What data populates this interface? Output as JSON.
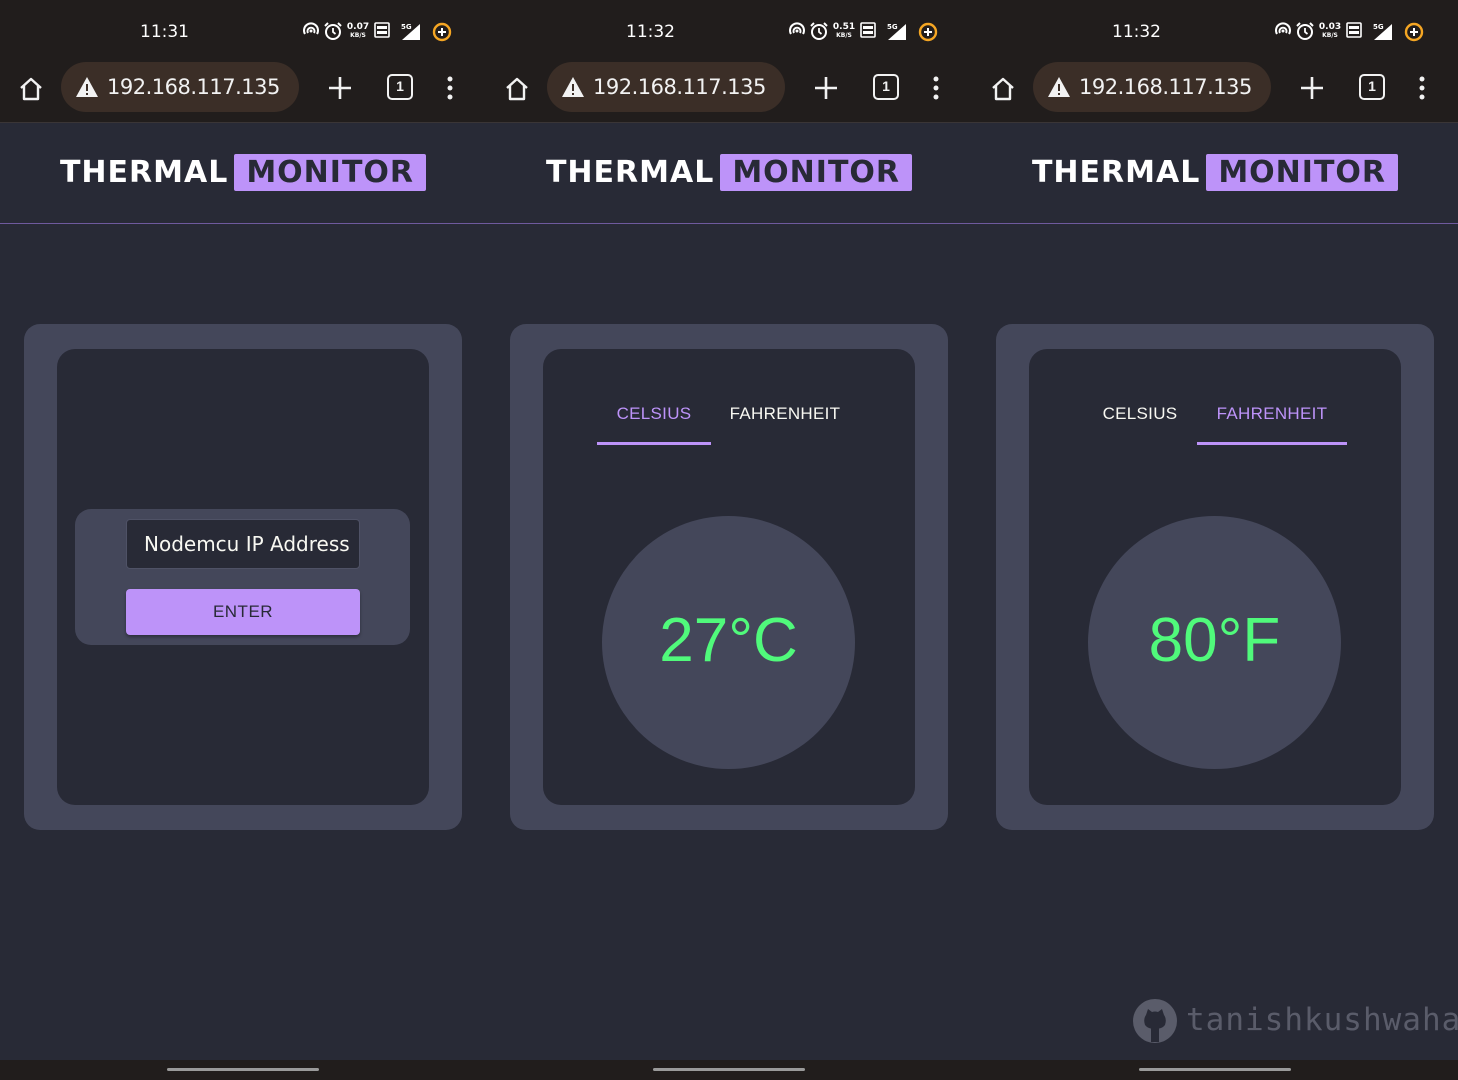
{
  "colors": {
    "background": "#282a36",
    "card": "#44475a",
    "accent": "#bd93f9",
    "reading": "#50fa7b",
    "text": "#f8f8f2",
    "system_bar": "#211d1c",
    "url_pill": "#3b2e27"
  },
  "screens": [
    {
      "status": {
        "time": "11:31",
        "speed_value": "0.07",
        "speed_unit": "KB/S",
        "network": "5G"
      },
      "browser": {
        "url": "192.168.117.135",
        "tab_count": "1"
      },
      "header": {
        "title_part1": "THERMAL",
        "title_part2": "MONITOR"
      },
      "form": {
        "ip_placeholder": "Nodemcu IP Address",
        "enter_label": "ENTER"
      }
    },
    {
      "status": {
        "time": "11:32",
        "speed_value": "0.51",
        "speed_unit": "KB/S",
        "network": "5G"
      },
      "browser": {
        "url": "192.168.117.135",
        "tab_count": "1"
      },
      "header": {
        "title_part1": "THERMAL",
        "title_part2": "MONITOR"
      },
      "tabs": {
        "celsius": "CELSIUS",
        "fahrenheit": "FAHRENHEIT",
        "active": "celsius"
      },
      "reading": "27°C"
    },
    {
      "status": {
        "time": "11:32",
        "speed_value": "0.03",
        "speed_unit": "KB/S",
        "network": "5G"
      },
      "browser": {
        "url": "192.168.117.135",
        "tab_count": "1"
      },
      "header": {
        "title_part1": "THERMAL",
        "title_part2": "MONITOR"
      },
      "tabs": {
        "celsius": "CELSIUS",
        "fahrenheit": "FAHRENHEIT",
        "active": "fahrenheit"
      },
      "reading": "80°F"
    }
  ],
  "watermark": {
    "icon": "github-icon",
    "text": "tanishkushwaha"
  }
}
